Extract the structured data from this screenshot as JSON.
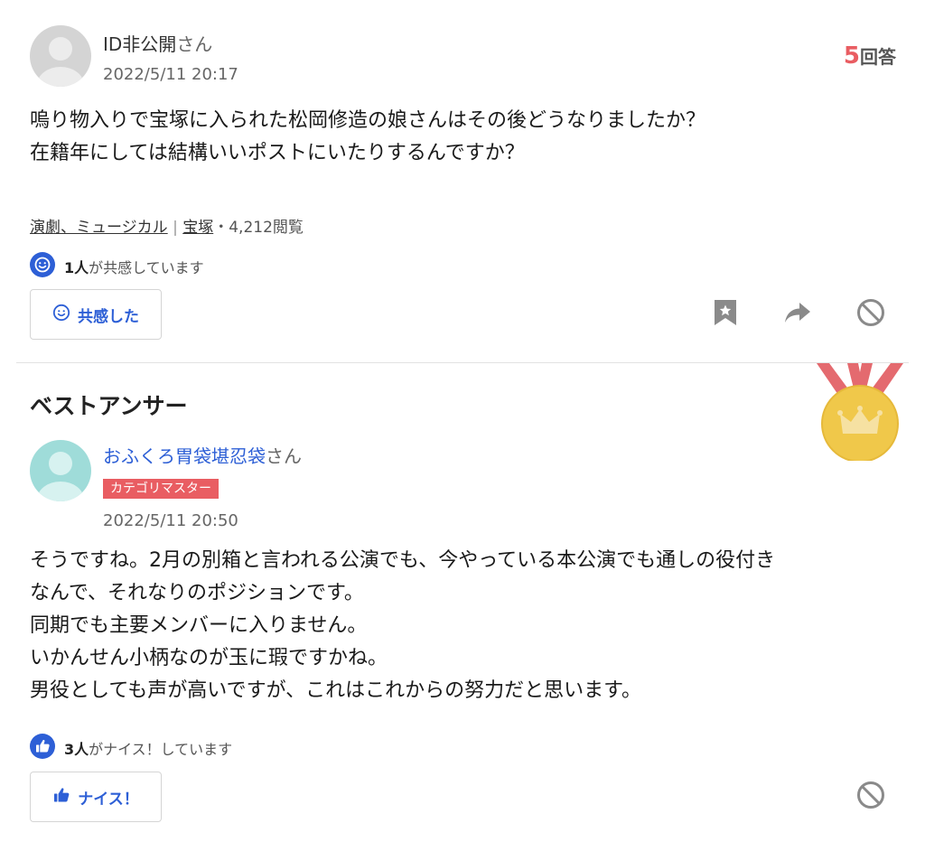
{
  "question": {
    "user_name": "ID非公開",
    "user_suffix": "さん",
    "date": "2022/5/11 20:17",
    "answer_count": "5",
    "answer_count_label": "回答",
    "body_lines": [
      "嗚り物入りで宝塚に入られた松岡修造の娘さんはその後どうなりましたか？",
      "在籍年にしては結構いいポストにいたりするんですか？"
    ],
    "category": "演劇、ミュージカル",
    "category_sep": "|",
    "tag": "宝塚",
    "views": "・4,212閲覧",
    "empathy_count": "1人",
    "empathy_text": "が共感しています",
    "empathy_button": "共感した"
  },
  "best_answer": {
    "heading": "ベストアンサー",
    "user_name": "おふくろ胃袋堪忍袋",
    "user_suffix": "さん",
    "badge": "カテゴリマスター",
    "date": "2022/5/11 20:50",
    "body_lines": [
      "そうですね。2月の別箱と言われる公演でも、今やっている本公演でも通しの役付き",
      "なんで、それなりのポジションです。",
      "同期でも主要メンバーに入りません。",
      "いかんせん小柄なのが玉に瑕ですかね。",
      "男役としても声が高いですが、これはこれからの努力だと思います。"
    ],
    "nice_count": "3人",
    "nice_text": "がナイス！しています",
    "nice_button": "ナイス！"
  },
  "colors": {
    "accent_blue": "#2d5fd6",
    "accent_red": "#e95d62",
    "medal_gold": "#f0c84a"
  }
}
